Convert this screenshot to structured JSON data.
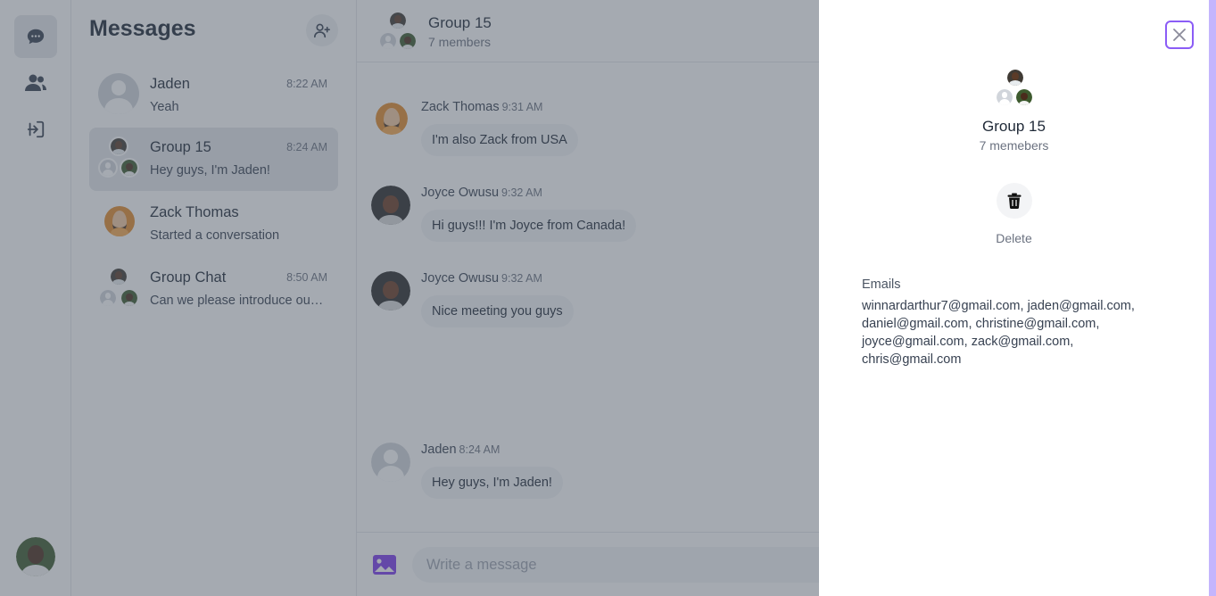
{
  "sidebar": {
    "icons": [
      "chat-bubble-icon",
      "users-icon",
      "logout-icon"
    ]
  },
  "conversations": {
    "title": "Messages",
    "items": [
      {
        "name": "Jaden",
        "time": "8:22 AM",
        "preview": "Yeah"
      },
      {
        "name": "Group 15",
        "time": "8:24 AM",
        "preview": "Hey guys, I'm Jaden!"
      },
      {
        "name": "Zack Thomas",
        "time": "",
        "preview": "Started a conversation"
      },
      {
        "name": "Group Chat",
        "time": "8:50 AM",
        "preview": "Can we please introduce ourselves"
      }
    ]
  },
  "chat": {
    "title": "Group 15",
    "subtitle": "7 members",
    "messages": [
      {
        "author": "Zack Thomas",
        "time": "9:31 AM",
        "text": "I'm also Zack from USA"
      },
      {
        "author": "Joyce Owusu",
        "time": "9:32 AM",
        "text": "Hi guys!!! I'm Joyce from Canada!"
      },
      {
        "author": "Joyce Owusu",
        "time": "9:32 AM",
        "text": "Nice meeting you guys"
      },
      {
        "author": "Jaden",
        "time": "8:24 AM",
        "text": "Hey guys, I'm Jaden!"
      }
    ],
    "composer_placeholder": "Write a message"
  },
  "details": {
    "title": "Group 15",
    "subtitle": "7 memebers",
    "delete_label": "Delete",
    "emails_label": "Emails",
    "emails": "winnardarthur7@gmail.com, jaden@gmail.com, daniel@gmail.com, christine@gmail.com, joyce@gmail.com, zack@gmail.com, chris@gmail.com"
  },
  "colors": {
    "accent": "#8b5cf6",
    "overlay": "#4b5563"
  }
}
